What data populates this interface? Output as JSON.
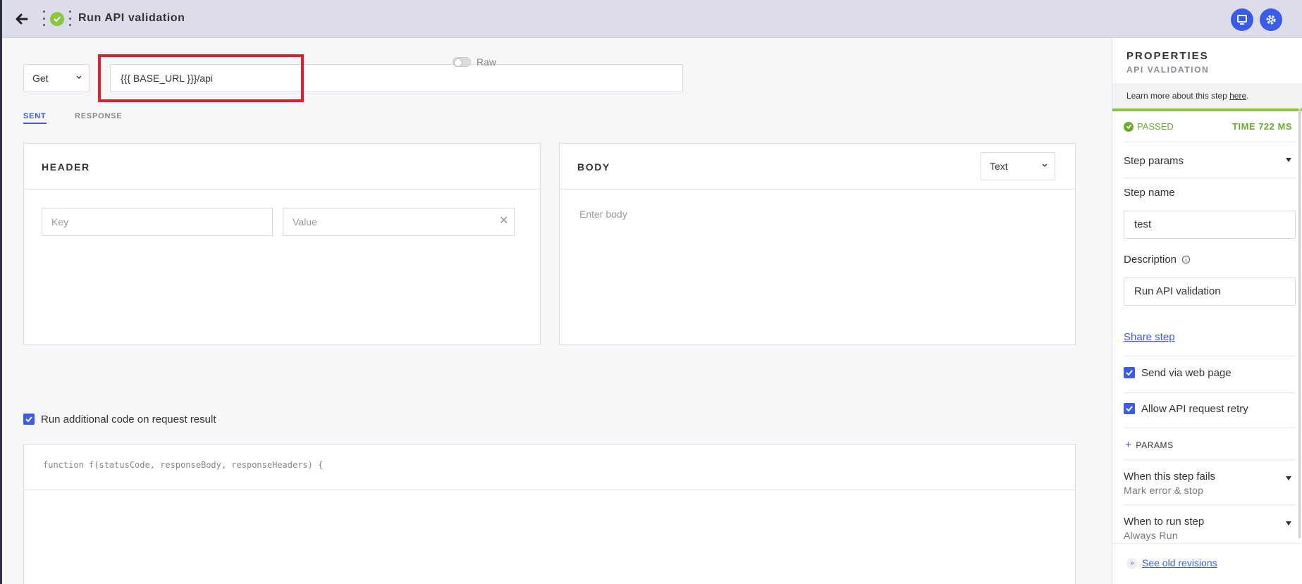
{
  "topbar": {
    "title": "Run API validation",
    "status_icon": "check-circle",
    "status_color": "#8cc63f",
    "accent": "#3a5ce8"
  },
  "request": {
    "method": "Get",
    "url": "{{{ BASE_URL }}}/api"
  },
  "tabs": {
    "sent": "SENT",
    "response": "RESPONSE",
    "active": "sent"
  },
  "header_panel": {
    "title": "HEADER",
    "raw_label": "Raw",
    "raw_enabled": false,
    "key_placeholder": "Key",
    "value_placeholder": "Value"
  },
  "body_panel": {
    "title": "BODY",
    "format": "Text",
    "placeholder": "Enter body"
  },
  "additional_code": {
    "label": "Run additional code on request result",
    "checked": true,
    "signature": "function f(statusCode, responseBody, responseHeaders) {"
  },
  "properties": {
    "title": "PROPERTIES",
    "subtitle": "API VALIDATION",
    "learn_text": "Learn more about this step ",
    "learn_link": "here",
    "learn_suffix": ".",
    "status": "PASSED",
    "time": "TIME 722 MS",
    "step_params": "Step params",
    "step_name_label": "Step name",
    "step_name_value": "test",
    "description_label": "Description",
    "description_value": "Run API validation",
    "share_step": "Share step",
    "send_via_web": "Send via web page",
    "allow_retry": "Allow API request retry",
    "params_label": "PARAMS",
    "fails_label": "When this step fails",
    "fails_value": "Mark error & stop",
    "run_label": "When to run step",
    "run_value": "Always Run",
    "old_revisions": "See old revisions",
    "status_color": "#6aab2e"
  }
}
